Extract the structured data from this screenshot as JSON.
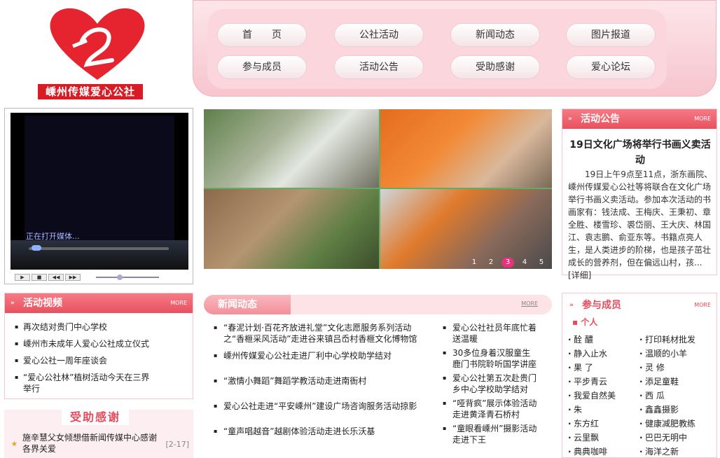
{
  "brand": {
    "name": "嵊州传媒爱心公社",
    "accent": "#e9515e",
    "logo_red": "#d81c25"
  },
  "nav": [
    {
      "label": "首　　页"
    },
    {
      "label": "公社活动"
    },
    {
      "label": "新闻动态"
    },
    {
      "label": "图片报道"
    },
    {
      "label": "参与成员"
    },
    {
      "label": "活动公告"
    },
    {
      "label": "受助感谢"
    },
    {
      "label": "爱心论坛"
    }
  ],
  "video": {
    "status": "正在打开媒体..."
  },
  "slideshow": {
    "pages": [
      "1",
      "2",
      "3",
      "4",
      "5"
    ],
    "active": "3"
  },
  "announce": {
    "head": "活动公告",
    "more": "MORE",
    "title": "19日文化广场将举行书画义卖活动",
    "body": "19日上午9点至11点，浙东画院、嵊州传媒爱心公社等将联合在文化广场举行书画义卖活动。参加本次活动的书画家有：钱法成、王梅庆、王秉初、章全胜、楼雪珍、裘岱丽、王大庆、林国江、袁志鹏、俞亚东等。书籍点亮人生，是人类进步的阶梯，也是孩子茁壮成长的营养剂，但在偏远山村，孩...",
    "detail": "[详细]"
  },
  "activity_video": {
    "head": "活动视频",
    "more": "MORE",
    "items": [
      "再次结对贵门中心学校",
      "嵊州市未成年人爱心公社成立仪式",
      "爱心公社一周年座谈会",
      "“爱心公社林”植树活动今天在三界举行"
    ]
  },
  "thanks": {
    "title": "受助感谢",
    "items": [
      {
        "text": "施辛慧父女倾想借新闻传媒中心感谢各界关爱",
        "date": "[2-17]"
      }
    ]
  },
  "news": {
    "head": "新闻动态",
    "more": "MORE",
    "left": [
      "“春泥计划·百花齐放进礼堂”文化志愿服务系列活动之“香榧采风活动”走进谷来镇吕岙村香榧文化博物馆",
      "嵊州传媒爱心公社走进厂利中心学校助学结对",
      "“激情小舞蹈”舞蹈学教活动走进南衙村",
      "爱心公社走进“平安嵊州”建设广场咨询服务活动掠影",
      "“童声唱越音”越剧体验活动走进长乐沃基"
    ],
    "right": [
      "爱心公社社员年底忙着送温暖",
      "30多位身着汉服童生 鹿门书院聆听国学讲座",
      "爱心公社第五次赴贵门乡中心学校助学结对",
      "“哑背疯”展示体验活动走进黄泽青石桥村",
      "“童眼看嵊州”摄影活动走进下王"
    ]
  },
  "members": {
    "head": "参与成员",
    "more": "MORE",
    "sub": "个人",
    "left": [
      "酫 醲",
      "静入止水",
      "果 了",
      "平步青云",
      "我爱自然美",
      "朱",
      "东方红",
      "云里飘",
      "典典咖啡"
    ],
    "right": [
      "打印耗材批发",
      "温顺的小羊",
      "灵 修",
      "添足童鞋",
      "西 瓜",
      "鑫鑫摄影",
      "健康减肥教练",
      "巴巴无明中",
      "海洋之新"
    ]
  }
}
